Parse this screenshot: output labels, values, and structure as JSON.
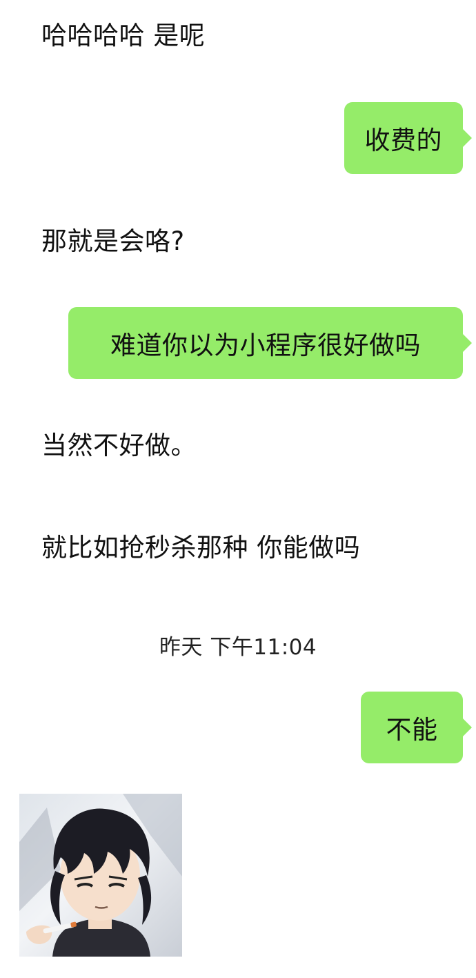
{
  "messages": [
    {
      "side": "incoming",
      "text": "哈哈哈哈 是呢"
    },
    {
      "side": "outgoing",
      "text": "收费的"
    },
    {
      "side": "incoming",
      "text": "那就是会咯?"
    },
    {
      "side": "outgoing",
      "text": "难道你以为小程序很好做吗"
    },
    {
      "side": "incoming",
      "text": "当然不好做。"
    },
    {
      "side": "incoming",
      "text": "就比如抢秒杀那种 你能做吗"
    },
    {
      "side": "outgoing",
      "text": "不能"
    }
  ],
  "timestamp": "昨天 下午11:04",
  "sticker": {
    "icon": "anime-boy-cigarette-sticker"
  },
  "colors": {
    "outgoing_bubble": "#95ec69",
    "background": "#ffffff",
    "text": "#111111"
  }
}
